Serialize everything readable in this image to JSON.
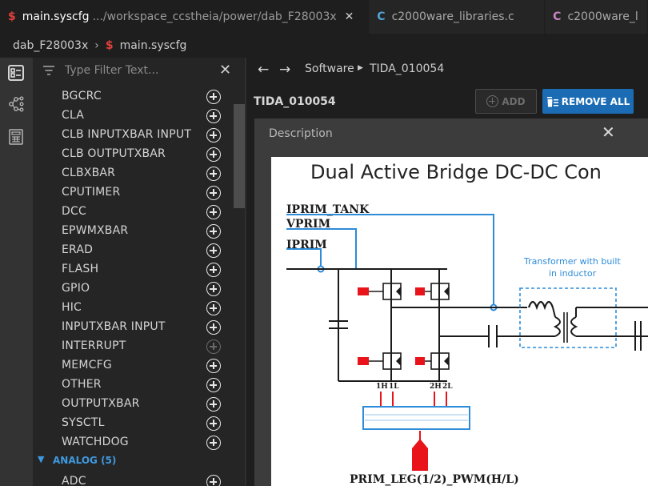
{
  "tabs": [
    {
      "icon": "$",
      "title": "main.syscfg",
      "path": ".../workspace_ccstheia/power/dab_F28003x",
      "close": "✕",
      "active": true
    },
    {
      "icon": "C",
      "title": "c2000ware_libraries.c",
      "active": false
    },
    {
      "icon": "C",
      "title": "c2000ware_l",
      "active": false
    }
  ],
  "breadcrumb": {
    "project": "dab_F28003x",
    "file": "main.syscfg"
  },
  "filter": {
    "placeholder": "Type Filter Text..."
  },
  "modules": [
    {
      "label": "BGCRC",
      "enabled": true
    },
    {
      "label": "CLA",
      "enabled": true
    },
    {
      "label": "CLB INPUTXBAR INPUT",
      "enabled": true
    },
    {
      "label": "CLB OUTPUTXBAR",
      "enabled": true
    },
    {
      "label": "CLBXBAR",
      "enabled": true
    },
    {
      "label": "CPUTIMER",
      "enabled": true
    },
    {
      "label": "DCC",
      "enabled": true
    },
    {
      "label": "EPWMXBAR",
      "enabled": true
    },
    {
      "label": "ERAD",
      "enabled": true
    },
    {
      "label": "FLASH",
      "enabled": true
    },
    {
      "label": "GPIO",
      "enabled": true
    },
    {
      "label": "HIC",
      "enabled": true
    },
    {
      "label": "INPUTXBAR INPUT",
      "enabled": true
    },
    {
      "label": "INTERRUPT",
      "enabled": false
    },
    {
      "label": "MEMCFG",
      "enabled": true
    },
    {
      "label": "OTHER",
      "enabled": true
    },
    {
      "label": "OUTPUTXBAR",
      "enabled": true
    },
    {
      "label": "SYSCTL",
      "enabled": true
    },
    {
      "label": "WATCHDOG",
      "enabled": true
    }
  ],
  "group": {
    "label": "ANALOG (5)",
    "first_item": "ADC"
  },
  "main": {
    "nav": {
      "crumb1": "Software",
      "crumb2": "TIDA_010054"
    },
    "title": "TIDA_010054",
    "add_label": "ADD",
    "remove_label": "REMOVE ALL",
    "description_title": "Description"
  },
  "diagram": {
    "heading": "Dual Active Bridge DC-DC Con",
    "signal1": "IPRIM_TANK",
    "signal2": "VPRIM",
    "signal3": "IPRIM",
    "transformer_line1": "Transformer with built",
    "transformer_line2": "in inductor",
    "pin1": "1H",
    "pin2": "1L",
    "pin3": "2H",
    "pin4": "2L",
    "bottom": "PRIM_LEG(1/2)_PWM(H/L)"
  },
  "colors": {
    "accent": "#1b6cb5",
    "group": "#3e9ae0",
    "signal": "#2e8bd8",
    "gate": "#e8141a"
  }
}
